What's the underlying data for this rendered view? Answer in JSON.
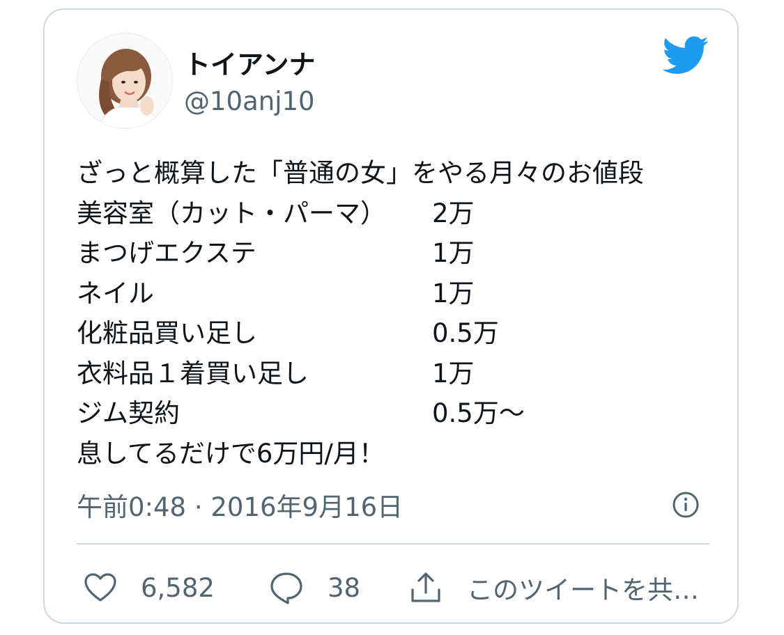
{
  "tweet": {
    "author": {
      "display_name": "トイアンナ",
      "handle": "@10anj10"
    },
    "logo_icon": "twitter-bird-icon",
    "body": {
      "intro": "ざっと概算した「普通の女」をやる月々のお値段",
      "items": [
        {
          "label": "美容室（カット・パーマ）",
          "price": "2万"
        },
        {
          "label": "まつげエクステ",
          "price": "1万"
        },
        {
          "label": "ネイル",
          "price": "1万"
        },
        {
          "label": "化粧品買い足し",
          "price": "0.5万"
        },
        {
          "label": "衣料品１着買い足し",
          "price": "1万"
        },
        {
          "label": "ジム契約",
          "price": "0.5万〜"
        }
      ],
      "conclusion": "息してるだけで6万円/月！"
    },
    "timestamp": "午前0:48 · 2016年9月16日",
    "actions": {
      "like_count": "6,582",
      "reply_count": "38",
      "share_label": "このツイートを共…"
    }
  },
  "colors": {
    "text": "#0f1419",
    "secondary": "#536471",
    "border": "#cfd9de",
    "twitter_blue": "#1d9bf0"
  }
}
